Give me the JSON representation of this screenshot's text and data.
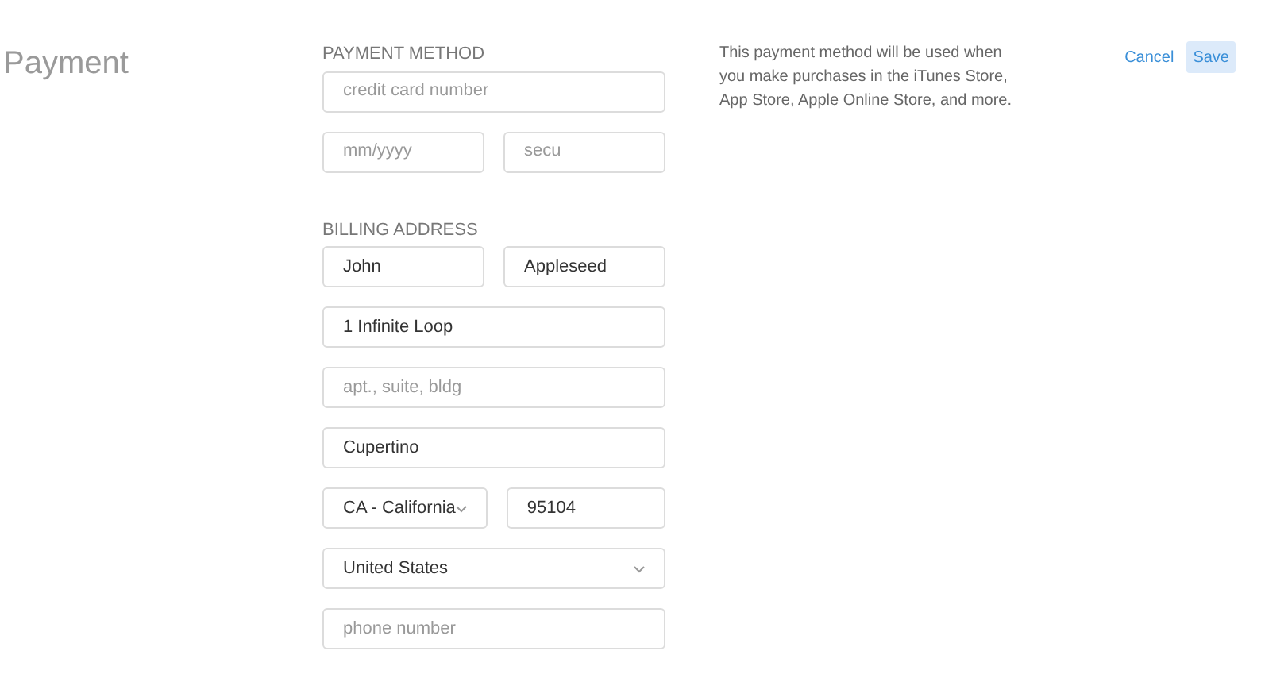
{
  "title": "Payment",
  "payment_method": {
    "heading": "PAYMENT METHOD",
    "rows": [
      [
        {
          "kind": "text",
          "placeholder": "credit card number"
        }
      ],
      [
        {
          "kind": "text",
          "placeholder": "mm/yyyy"
        },
        {
          "kind": "text",
          "placeholder": "secu"
        }
      ]
    ]
  },
  "billing_address": {
    "heading": "BILLING ADDRESS",
    "rows": [
      [
        {
          "kind": "text",
          "value": "John"
        },
        {
          "kind": "text",
          "value": "Appleseed"
        }
      ],
      [
        {
          "kind": "text",
          "value": "1 Infinite Loop"
        }
      ],
      [
        {
          "kind": "text",
          "placeholder": "apt., suite, bldg"
        }
      ],
      [
        {
          "kind": "text",
          "value": "Cupertino"
        }
      ],
      [
        {
          "kind": "select",
          "value": "CA - California"
        },
        {
          "kind": "text",
          "value": "95104"
        }
      ],
      [
        {
          "kind": "select",
          "value": "United States"
        }
      ],
      [
        {
          "kind": "text",
          "placeholder": "phone number"
        }
      ]
    ]
  },
  "note": "This payment method will be used when you make purchases in the iTunes Store, App Store, Apple Online Store, and more.",
  "buttons": [
    {
      "label": "Cancel",
      "kind": "secondary"
    },
    {
      "label": "Save",
      "kind": "primary"
    }
  ]
}
